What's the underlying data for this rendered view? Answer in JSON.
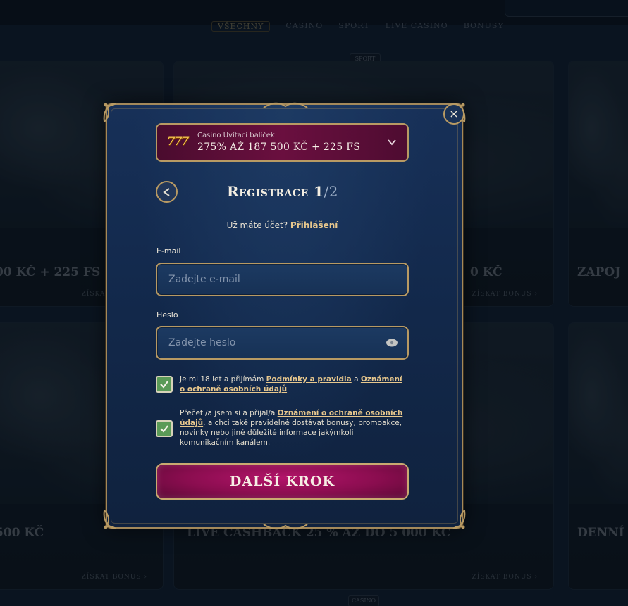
{
  "background": {
    "nav": [
      "VŠECHNY",
      "CASINO",
      "SPORT",
      "LIVE CASINO",
      "BONUSY"
    ],
    "chips": [
      "SPORT",
      "CASINO"
    ],
    "cards": [
      {
        "caption": "00 KČ + 225 FS",
        "link": "ZÍSKAT BONUS ›"
      },
      {
        "caption": "",
        "link": ""
      },
      {
        "caption": "0 KČ",
        "link": "ZÍSKAT BONUS ›"
      },
      {
        "caption": "ZAPOJ",
        "link": ""
      },
      {
        "caption": "500 KČ",
        "link": "ZÍSKAT BONUS ›"
      },
      {
        "caption": "LIVE CASHBACK 25 % AŽ DO 5 000 KČ",
        "link": "ZÍSKAT BONUS ›"
      },
      {
        "caption": "DENNÍ",
        "link": ""
      }
    ]
  },
  "modal": {
    "promo": {
      "icon_text": "777",
      "small": "Casino Uvítací balíček",
      "big": "275% AŽ 187 500 KČ + 225 FS"
    },
    "title": "Registrace 1",
    "title_step": "/2",
    "login_prompt": "Už máte účet?",
    "login_link": "Přihlášení",
    "email": {
      "label": "E-mail",
      "placeholder": "Zadejte e-mail",
      "value": ""
    },
    "password": {
      "label": "Heslo",
      "placeholder": "Zadejte heslo",
      "value": ""
    },
    "consent1": {
      "checked": true,
      "text_a": "Je mi 18 let a přijímám ",
      "link_a": "Podmínky a pravidla",
      "text_b": " a ",
      "link_b": "Oznámení o ochraně osobních údajů"
    },
    "consent2": {
      "checked": true,
      "text_a": "Přečetl/a jsem si a přijal/a ",
      "link_a": "Oznámení o ochraně osobních údajů",
      "text_b": ", a chci také pravidelně dostávat bonusy, promoakce, novinky nebo jiné důležité informace jakýmkoli komunikačním kanálem."
    },
    "cta_label": "DALŠÍ KROK",
    "close_glyph": "×"
  },
  "colors": {
    "gold": "#b89a63",
    "cta": "#8a0d4f",
    "modal_bg": "#173058",
    "checkbox": "#5a9a57"
  }
}
